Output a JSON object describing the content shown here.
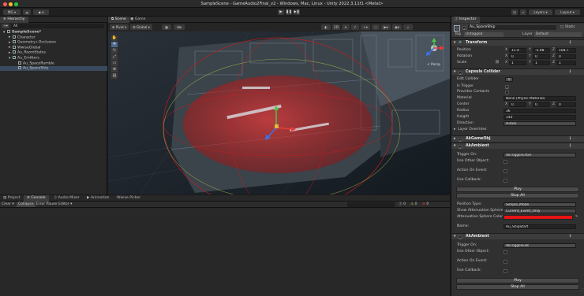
{
  "window": {
    "title": "SampleScene - GameAudio2Final_v2 - Windows, Mac, Linux - Unity 2022.3.11f1 <Metal>"
  },
  "toolbar": {
    "account_label": "MG",
    "cloud_icon": "cloud-icon",
    "play_icon": "▶",
    "pause_icon": "❚❚",
    "step_icon": "▶❚",
    "layers_label": "Layers",
    "layout_label": "Layout"
  },
  "hierarchy": {
    "tab_label": "Hierarchy",
    "search_label": "All",
    "items": [
      {
        "label": "SampleScene*",
        "indent": 0,
        "selected": false
      },
      {
        "label": "Character",
        "indent": 1,
        "selected": false
      },
      {
        "label": "Geometry+Occlusion",
        "indent": 1,
        "selected": false
      },
      {
        "label": "WwiseGlobal",
        "indent": 1,
        "selected": false
      },
      {
        "label": "Au_RoomStates",
        "indent": 1,
        "selected": false
      },
      {
        "label": "Au_Emitters",
        "indent": 1,
        "selected": false
      },
      {
        "label": "Au_SpaceRumble",
        "indent": 2,
        "selected": false
      },
      {
        "label": "Au_SpaceShip",
        "indent": 2,
        "selected": true
      }
    ]
  },
  "scene": {
    "tabs": [
      "Scene",
      "Game"
    ],
    "pivot_label": "Pivot",
    "global_label": "Global",
    "persp_label": "< Persp"
  },
  "bottom": {
    "tabs": [
      "Project",
      "Console",
      "Audio Mixer",
      "Animation",
      "Wwise Picker"
    ],
    "clear_label": "Clear",
    "collapse_label": "Collapse",
    "error_pause_label": "Error Pause",
    "editor_label": "Editor",
    "count_errors": "0",
    "count_warnings": "0",
    "count_logs": "0"
  },
  "inspector": {
    "tab_label": "Inspector",
    "object_name": "Au_SpaceShip",
    "static_label": "Static",
    "tag_label": "Tag",
    "tag_value": "Untagged",
    "layer_label": "Layer",
    "layer_value": "Default",
    "transform": {
      "title": "Transform",
      "position_label": "Position",
      "rotation_label": "Rotation",
      "scale_label": "Scale",
      "position": [
        "11.4",
        "-5.98",
        "108.7"
      ],
      "rotation": [
        "0",
        "0",
        "0"
      ],
      "scale": [
        "1",
        "1",
        "1"
      ]
    },
    "capsule": {
      "title": "Capsule Collider",
      "edit_collider_label": "Edit Collider",
      "is_trigger_label": "Is Trigger",
      "provides_contacts_label": "Provides Contacts",
      "material_label": "Material",
      "material_value": "None (Physic Material)",
      "center_label": "Center",
      "center": [
        "0",
        "0",
        "0"
      ],
      "radius_label": "Radius",
      "radius_value": "36",
      "height_label": "Height",
      "height_value": "140",
      "direction_label": "Direction",
      "direction_value": "X-Axis",
      "layer_overrides_label": "Layer Overrides"
    },
    "akgameobj_title": "AkGameObj",
    "ambient1": {
      "title": "AkAmbient",
      "trigger_on_label": "Trigger On:",
      "trigger_on_value": "AkTriggerEnter",
      "use_other_label": "Use Other Object:",
      "action_on_event_label": "Action On Event:",
      "use_callback_label": "Use Callback:",
      "play_label": "Play",
      "stop_all_label": "Stop All",
      "position_type_label": "Position Type:",
      "position_type_value": "Simple_Mode",
      "show_attenuation_label": "Show Attenuation Sphere",
      "show_attenuation_value": "Current_Event_Only",
      "attenuation_color_label": "Attenuation Sphere Color",
      "attenuation_color": "#e81414",
      "name_label": "Name:",
      "name_value": "Au_ShipStart"
    },
    "ambient2": {
      "title": "AkAmbient",
      "trigger_on_label": "Trigger On:",
      "trigger_on_value": "AkTriggerExit",
      "use_other_label": "Use Other Object:",
      "action_on_event_label": "Action On Event:",
      "use_callback_label": "Use Callback:",
      "play_label": "Play",
      "stop_all_label": "Stop All"
    }
  },
  "colors": {
    "accent_blue": "#3a72c4",
    "selection": "#3a4a5e",
    "sphere_red": "#c81e1e"
  }
}
